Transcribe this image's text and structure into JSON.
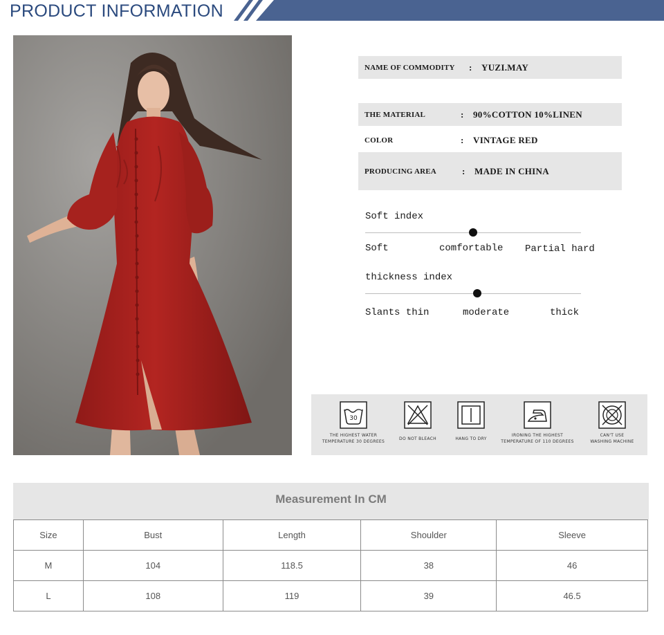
{
  "header": {
    "title": "PRODUCT INFORMATION",
    "accent_color": "#4a6391"
  },
  "specs": [
    {
      "label": "NAME OF COMMODITY",
      "value": "YUZI.MAY"
    },
    {
      "label": "THE MATERIAL",
      "value": "90%COTTON 10%LINEN"
    },
    {
      "label": "COLOR",
      "value": "VINTAGE RED"
    },
    {
      "label": "PRODUCING AREA",
      "value": "MADE IN CHINA"
    }
  ],
  "spec_colon": ":",
  "soft_index": {
    "title": "Soft index",
    "labels": [
      "Soft",
      "comfortable",
      "Partial hard"
    ],
    "level": 0.5
  },
  "thickness_index": {
    "title": "thickness index",
    "labels": [
      "Slants thin",
      "moderate",
      "thick"
    ],
    "level": 0.52
  },
  "care": [
    {
      "icon": "wash-30-icon",
      "caption_1": "THE HIGHEST WATER",
      "caption_2": "TEMPERATURE 30 DEGREES",
      "number": "30"
    },
    {
      "icon": "do-not-bleach-icon",
      "caption_1": "DO NOT BLEACH",
      "caption_2": ""
    },
    {
      "icon": "hang-to-dry-icon",
      "caption_1": "HANG TO DRY",
      "caption_2": ""
    },
    {
      "icon": "iron-icon",
      "caption_1": "IRONING THE HIGHEST",
      "caption_2": "TEMPERATURE OF 110 DEGREES"
    },
    {
      "icon": "no-machine-wash-icon",
      "caption_1": "CAN'T USE",
      "caption_2": "WASHING MACHINE"
    }
  ],
  "measurement": {
    "title": "Measurement In CM",
    "headers": [
      "Size",
      "Bust",
      "Length",
      "Shoulder",
      "Sleeve"
    ],
    "rows": [
      [
        "M",
        "104",
        "118.5",
        "38",
        "46"
      ],
      [
        "L",
        "108",
        "119",
        "39",
        "46.5"
      ]
    ]
  },
  "dress_color": "#a8201d"
}
